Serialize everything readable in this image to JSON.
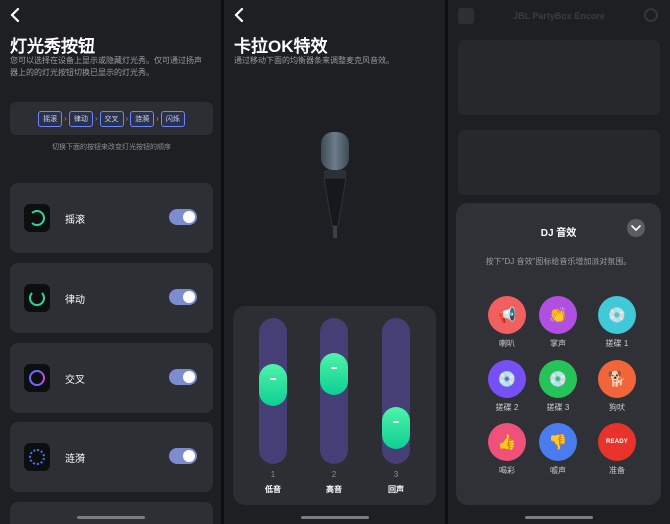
{
  "panel1": {
    "title": "灯光秀按钮",
    "description_line1": "您可以选择在设备上显示或隐藏灯光秀。仅可通过扬声",
    "description_line2": "器上的的灯光按钮切换已显示的灯光秀。",
    "order": [
      "摇滚",
      "律动",
      "交叉",
      "涟漪",
      "闪烁"
    ],
    "order_hint": "切换下面的按钮来改变灯光按钮的顺序",
    "rows": [
      {
        "label": "摇滚",
        "on": true,
        "ring_color": "#2bd99a"
      },
      {
        "label": "律动",
        "on": true,
        "ring_color": "#2bd99a"
      },
      {
        "label": "交叉",
        "on": true,
        "ring_color": "#6f6bff"
      },
      {
        "label": "涟漪",
        "on": true,
        "ring_color": "#3a7bff"
      }
    ]
  },
  "panel2": {
    "title": "卡拉OK特效",
    "description": "通过移动下面的均衡器条来调整麦克风音效。",
    "sliders": [
      {
        "num": "1",
        "name": "低音",
        "level": 0.56
      },
      {
        "num": "2",
        "name": "高音",
        "level": 0.66
      },
      {
        "num": "3",
        "name": "回声",
        "level": 0.14
      }
    ]
  },
  "panel3": {
    "background_title": "JBL PartyBox Encore",
    "card_title": "DJ 音效",
    "hint": "按下\"DJ 音效\"图标给音乐增加派对氛围。",
    "effects": [
      {
        "label": "喇叭",
        "icon": "horn-icon",
        "glyph": "📢",
        "color": "#f0605e"
      },
      {
        "label": "掌声",
        "icon": "clap-icon",
        "glyph": "👏",
        "color": "#b04fe0"
      },
      {
        "label": "搓碟 1",
        "icon": "disc-1-icon",
        "glyph": "💿",
        "color": "#3fc9d9"
      },
      {
        "label": "搓碟 2",
        "icon": "disc-2-icon",
        "glyph": "💿",
        "color": "#7450f5"
      },
      {
        "label": "搓碟 3",
        "icon": "disc-3-icon",
        "glyph": "💿",
        "color": "#25c35a"
      },
      {
        "label": "狗吠",
        "icon": "dog-icon",
        "glyph": "🐕",
        "color": "#f2653a"
      },
      {
        "label": "喝彩",
        "icon": "thumbs-up-icon",
        "glyph": "👍",
        "color": "#f0517a"
      },
      {
        "label": "嘘声",
        "icon": "thumbs-down-icon",
        "glyph": "👎",
        "color": "#4a7cf0"
      },
      {
        "label": "准备",
        "icon": "ready-icon",
        "glyph": "READY",
        "color": "#e8332b"
      }
    ]
  }
}
